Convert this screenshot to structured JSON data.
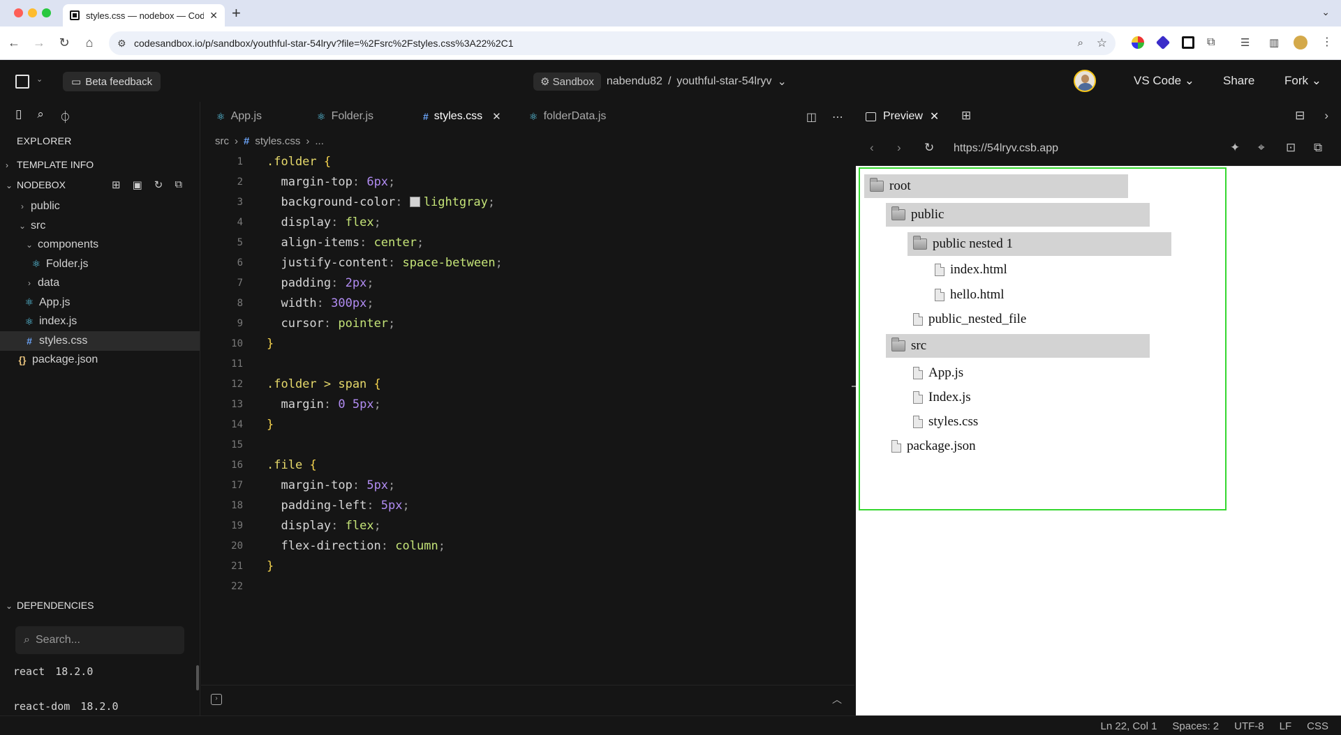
{
  "browser": {
    "tab_title": "styles.css — nodebox — Cod",
    "tab_close": "✕",
    "new_tab": "+",
    "url": "codesandbox.io/p/sandbox/youthful-star-54lryv?file=%2Fsrc%2Fstyles.css%3A22%2C1"
  },
  "header": {
    "beta_feedback": "Beta feedback",
    "sandbox_label": "Sandbox",
    "owner": "nabendu82",
    "separator": "/",
    "project": "youthful-star-54lryv",
    "editor_mode": "VS Code",
    "share": "Share",
    "fork": "Fork"
  },
  "sidebar": {
    "title": "EXPLORER",
    "template_info": "TEMPLATE INFO",
    "project_section": "NODEBOX",
    "tree": [
      {
        "label": "public",
        "type": "folder",
        "chevron": "›",
        "indent": 0
      },
      {
        "label": "src",
        "type": "folder",
        "chevron": "⌄",
        "indent": 0
      },
      {
        "label": "components",
        "type": "folder",
        "chevron": "⌄",
        "indent": 1
      },
      {
        "label": "Folder.js",
        "type": "react",
        "indent": 2
      },
      {
        "label": "data",
        "type": "folder",
        "chevron": "›",
        "indent": 1
      },
      {
        "label": "App.js",
        "type": "react",
        "indent": 1
      },
      {
        "label": "index.js",
        "type": "react",
        "indent": 1
      },
      {
        "label": "styles.css",
        "type": "css",
        "indent": 1,
        "selected": true
      },
      {
        "label": "package.json",
        "type": "json",
        "indent": 0
      }
    ],
    "dependencies_title": "DEPENDENCIES",
    "search_placeholder": "Search...",
    "dependencies": [
      {
        "name": "react",
        "version": "18.2.0"
      },
      {
        "name": "react-dom",
        "version": "18.2.0"
      }
    ]
  },
  "editor": {
    "tabs": [
      {
        "label": "App.js",
        "icon": "react"
      },
      {
        "label": "Folder.js",
        "icon": "react"
      },
      {
        "label": "styles.css",
        "icon": "css",
        "active": true
      },
      {
        "label": "folderData.js",
        "icon": "react"
      }
    ],
    "breadcrumb": {
      "folder": "src",
      "file": "styles.css",
      "more": "..."
    },
    "line_numbers": [
      "1",
      "2",
      "3",
      "4",
      "5",
      "6",
      "7",
      "8",
      "9",
      "10",
      "11",
      "12",
      "13",
      "14",
      "15",
      "16",
      "17",
      "18",
      "19",
      "20",
      "21",
      "22"
    ],
    "code": {
      "l1_sel": ".folder",
      "l1_brace": "{",
      "l2_prop": "margin-top",
      "l2_val": "6px",
      "l3_prop": "background-color",
      "l3_val": "lightgray",
      "l4_prop": "display",
      "l4_val": "flex",
      "l5_prop": "align-items",
      "l5_val": "center",
      "l6_prop": "justify-content",
      "l6_val": "space-between",
      "l7_prop": "padding",
      "l7_val": "2px",
      "l8_prop": "width",
      "l8_val": "300px",
      "l9_prop": "cursor",
      "l9_val": "pointer",
      "l10_brace": "}",
      "l12_sel": ".folder > span",
      "l12_brace": "{",
      "l13_prop": "margin",
      "l13_val": "0 5px",
      "l14_brace": "}",
      "l16_sel": ".file",
      "l16_brace": "{",
      "l17_prop": "margin-top",
      "l17_val": "5px",
      "l18_prop": "padding-left",
      "l18_val": "5px",
      "l19_prop": "display",
      "l19_val": "flex",
      "l20_prop": "flex-direction",
      "l20_val": "column",
      "l21_brace": "}"
    },
    "swatch_color": "#d3d3d3"
  },
  "preview": {
    "tab_label": "Preview",
    "url": "https://54lryv.csb.app",
    "tree": {
      "root": "root",
      "public": "public",
      "public_nested_1": "public nested 1",
      "index_html": "index.html",
      "hello_html": "hello.html",
      "public_nested_file": "public_nested_file",
      "src": "src",
      "app_js": "App.js",
      "index_js": "Index.js",
      "styles_css": "styles.css",
      "package_json": "package.json"
    }
  },
  "statusbar": {
    "position": "Ln 22, Col 1",
    "spaces": "Spaces: 2",
    "encoding": "UTF-8",
    "eol": "LF",
    "language": "CSS"
  },
  "colors": {
    "highlight_border": "#35d72f",
    "folder_bg": "#d3d3d3",
    "editor_bg": "#151515"
  }
}
